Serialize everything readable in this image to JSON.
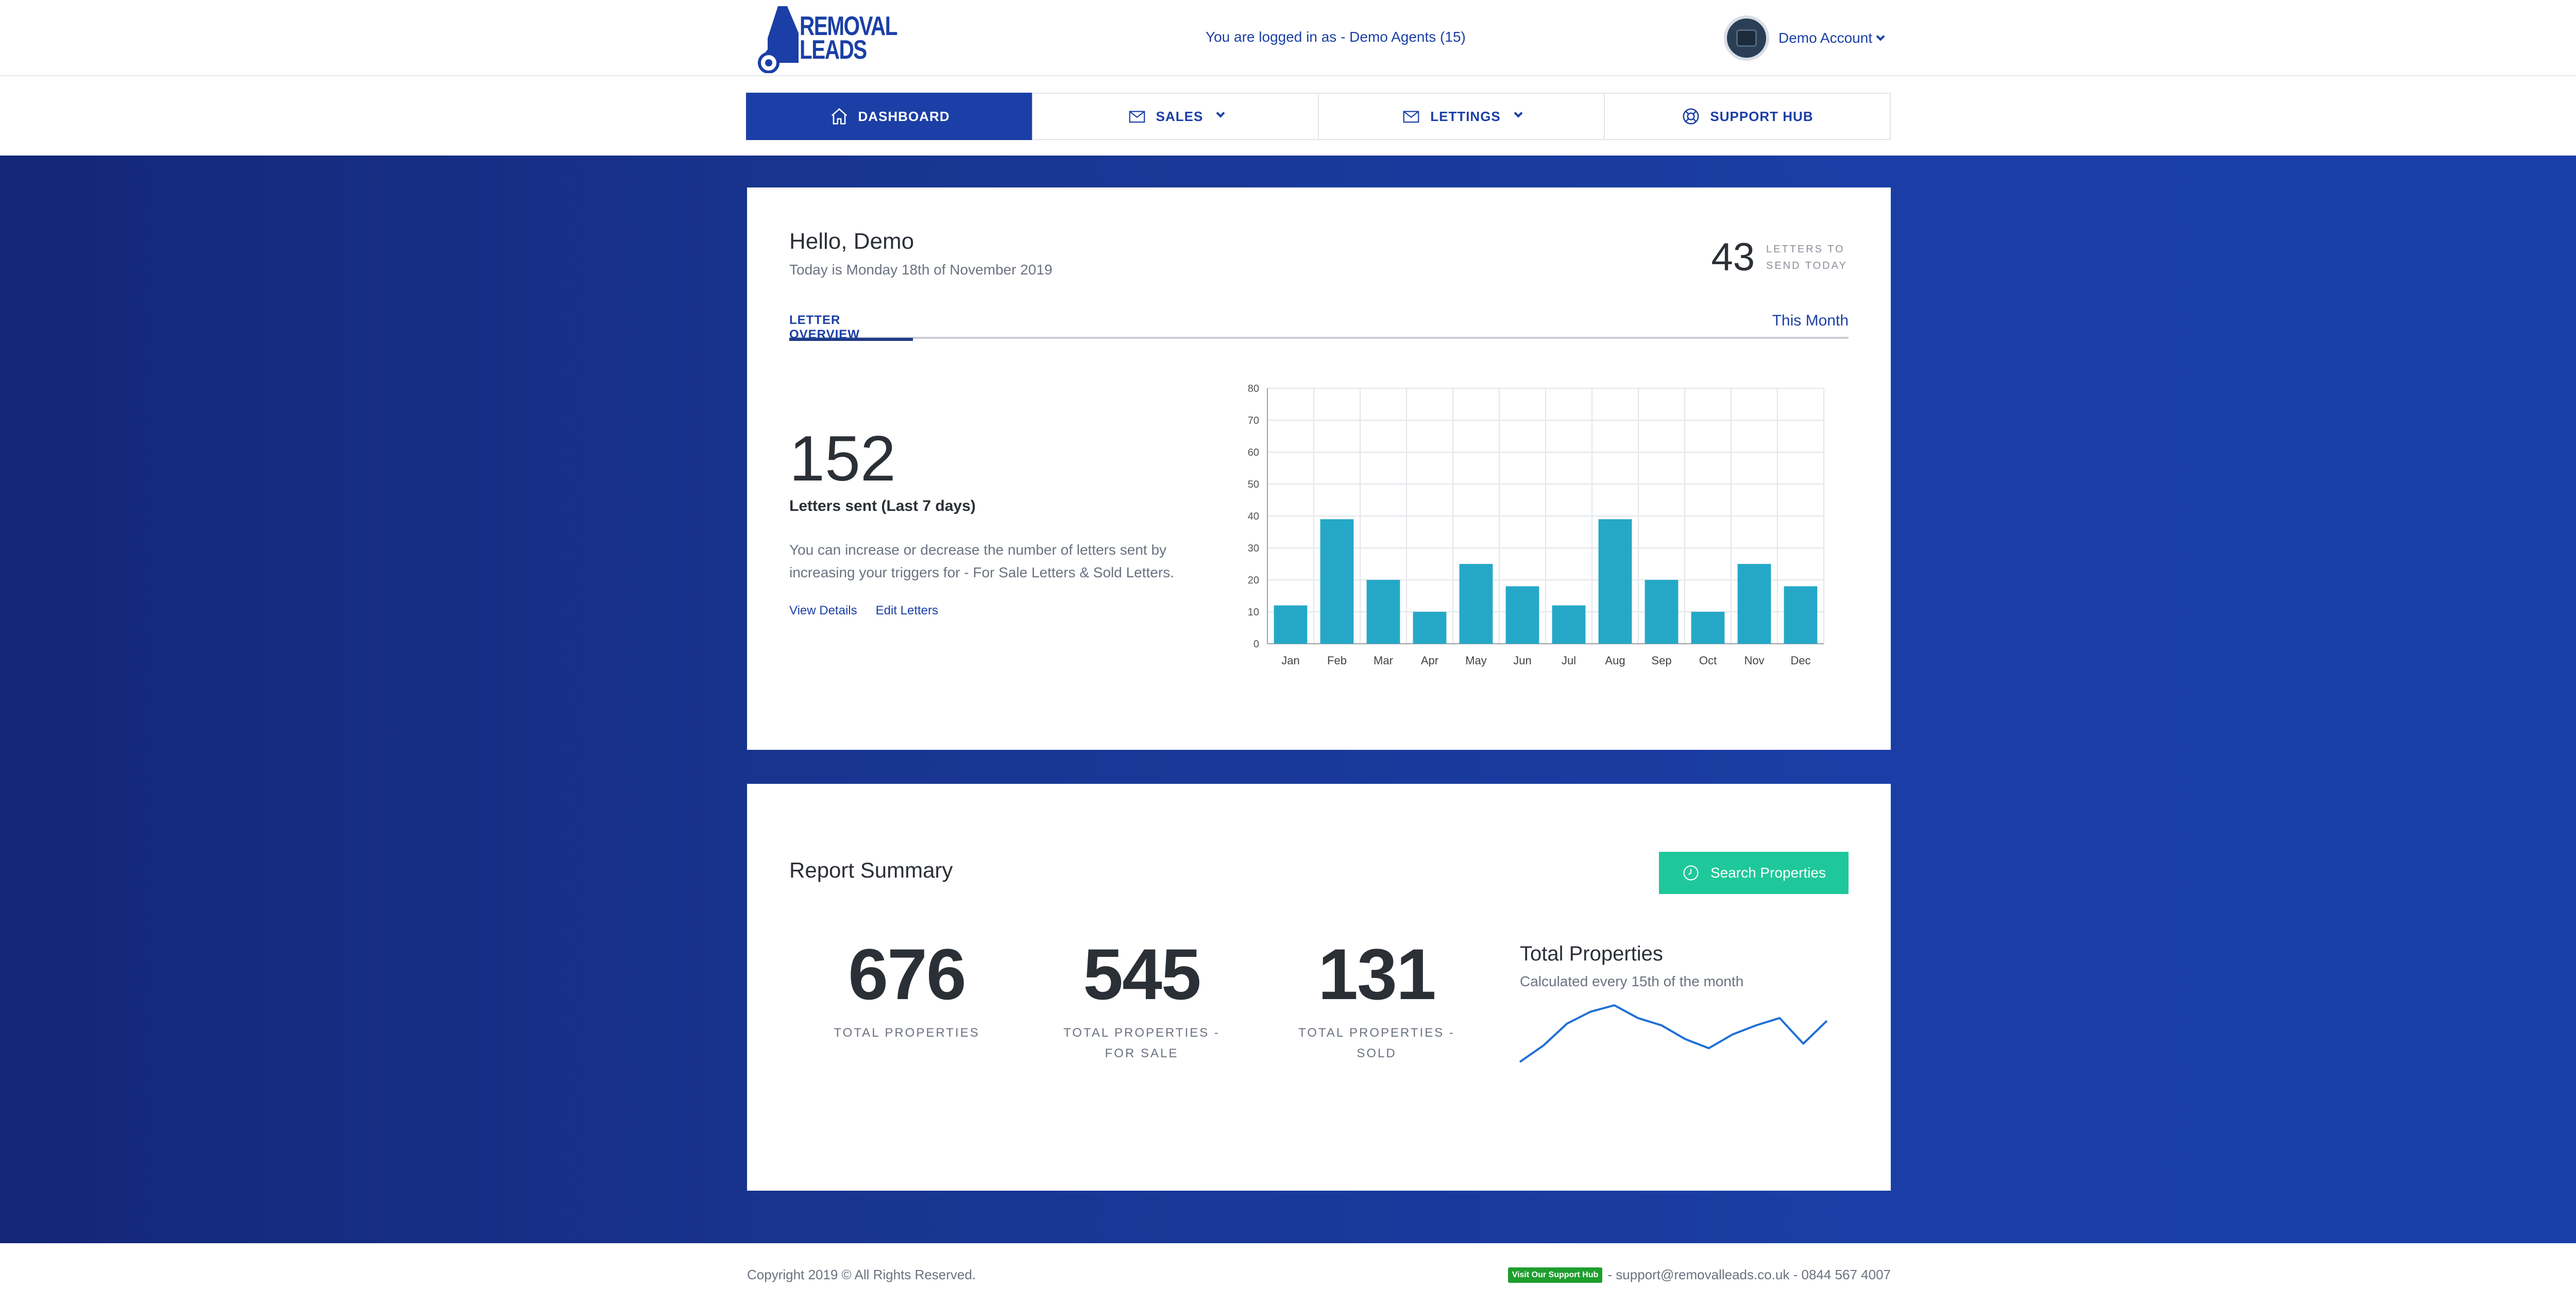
{
  "header": {
    "logo_text_line1": "REMOVAL",
    "logo_text_line2": "LEADS",
    "logged_in_text": "You are logged in as - Demo Agents (15)",
    "account_name": "Demo Account"
  },
  "nav": {
    "items": [
      {
        "label": "DASHBOARD",
        "icon": "home-icon",
        "active": true
      },
      {
        "label": "SALES",
        "icon": "envelope-icon",
        "dropdown": true
      },
      {
        "label": "LETTINGS",
        "icon": "envelope-icon",
        "dropdown": true
      },
      {
        "label": "SUPPORT HUB",
        "icon": "lifebuoy-icon"
      }
    ]
  },
  "overview": {
    "greeting": "Hello, Demo",
    "date_text": "Today is Monday 18th of November 2019",
    "letters_today_count": "43",
    "letters_today_label": "LETTERS TO SEND TODAY",
    "tab_label": "LETTER OVERVIEW",
    "period_label": "This Month",
    "letters_sent_count": "152",
    "letters_sent_label": "Letters sent (Last 7 days)",
    "description": "You can increase or decrease the number of letters sent by increasing your triggers for - For Sale Letters & Sold Letters.",
    "view_details_label": "View Details",
    "edit_letters_label": "Edit Letters"
  },
  "chart_data": {
    "type": "bar",
    "categories": [
      "Jan",
      "Feb",
      "Mar",
      "Apr",
      "May",
      "Jun",
      "Jul",
      "Aug",
      "Sep",
      "Oct",
      "Nov",
      "Dec"
    ],
    "values": [
      12,
      39,
      20,
      10,
      25,
      18,
      12,
      39,
      20,
      10,
      25,
      18
    ],
    "ylim": [
      0,
      80
    ],
    "yticks": [
      0,
      10,
      20,
      30,
      40,
      50,
      60,
      70,
      80
    ],
    "grid": true,
    "title": "",
    "xlabel": "",
    "ylabel": "",
    "color": "#25a8c7"
  },
  "report": {
    "title": "Report Summary",
    "search_button_label": "Search Properties",
    "stats": [
      {
        "value": "676",
        "label": "TOTAL PROPERTIES"
      },
      {
        "value": "545",
        "label": "TOTAL PROPERTIES - FOR SALE"
      },
      {
        "value": "131",
        "label": "TOTAL PROPERTIES - SOLD"
      }
    ],
    "total_title": "Total Properties",
    "total_subtitle": "Calculated every 15th of the month",
    "sparkline": [
      0,
      18,
      42,
      55,
      62,
      48,
      40,
      25,
      15,
      30,
      40,
      48,
      20,
      45
    ],
    "sparkline_color": "#1f6fd6"
  },
  "footer": {
    "copyright": "Copyright 2019 © All Rights Reserved.",
    "hub_badge": "Visit Our Support Hub",
    "contact": "- support@removalleads.co.uk - 0844 567 4007"
  },
  "colors": {
    "brand_blue": "#1b3fa6",
    "accent_green": "#1fc89a"
  }
}
